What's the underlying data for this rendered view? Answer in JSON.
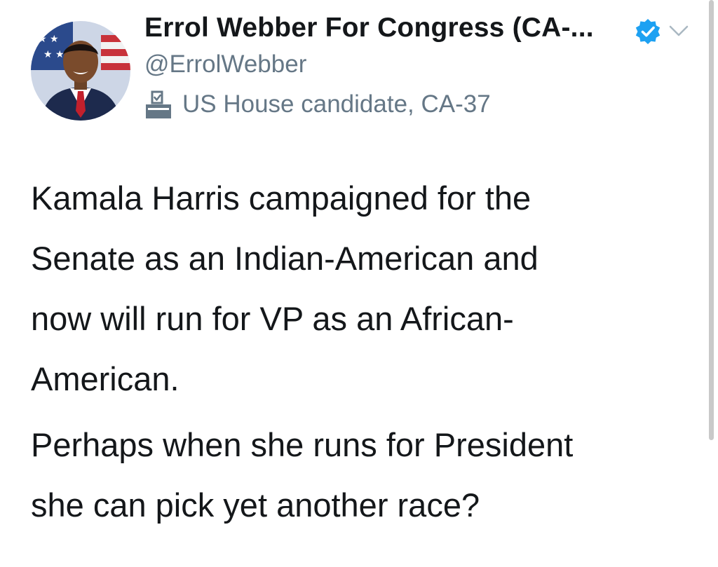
{
  "tweet": {
    "display_name": "Errol Webber For Congress (CA-...",
    "handle": "@ErrolWebber",
    "label": "US House candidate, CA-37",
    "paragraph_1": "Kamala Harris campaigned for the\nSenate as an Indian-American and\nnow will run for VP as an African-\nAmerican.",
    "paragraph_2": "Perhaps when she runs for President\nshe can pick yet another race?"
  },
  "icons": {
    "verified": "verified-badge-icon",
    "label": "ballot-box-icon",
    "menu": "chevron-down-icon"
  },
  "colors": {
    "verified_blue": "#1da1f2",
    "text_primary": "#14171a",
    "text_secondary": "#657786"
  }
}
